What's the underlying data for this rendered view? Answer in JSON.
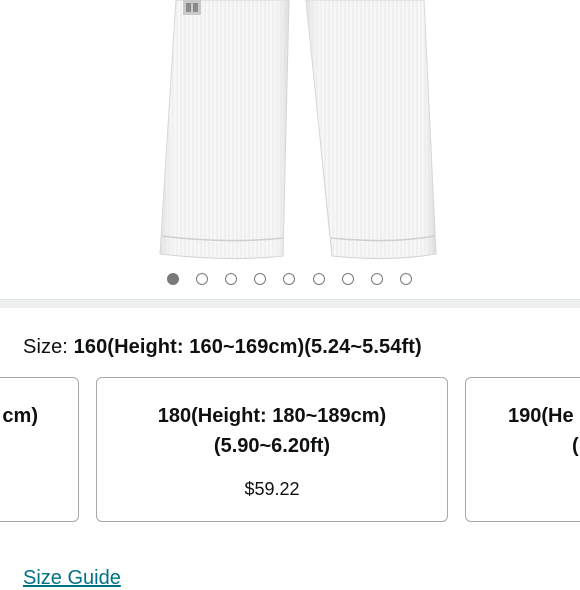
{
  "product": {
    "image_alt": "White martial arts uniform pants",
    "image_count": 9,
    "active_image": 1
  },
  "size": {
    "label": "Size:",
    "selected": "160(Height: 160~169cm)(5.24~5.54ft)"
  },
  "size_options": [
    {
      "name": "cm)",
      "price": ""
    },
    {
      "name_line1": "180(Height: 180~189cm)",
      "name_line2": "(5.90~6.20ft)",
      "price": "$59.22"
    },
    {
      "name_line1": "190(He",
      "name_line2": "(",
      "price": ""
    }
  ],
  "links": {
    "size_guide": "Size Guide"
  },
  "colors": {
    "link": "#007185",
    "border": "#a8a8a8",
    "dot": "#7a7a7a"
  }
}
